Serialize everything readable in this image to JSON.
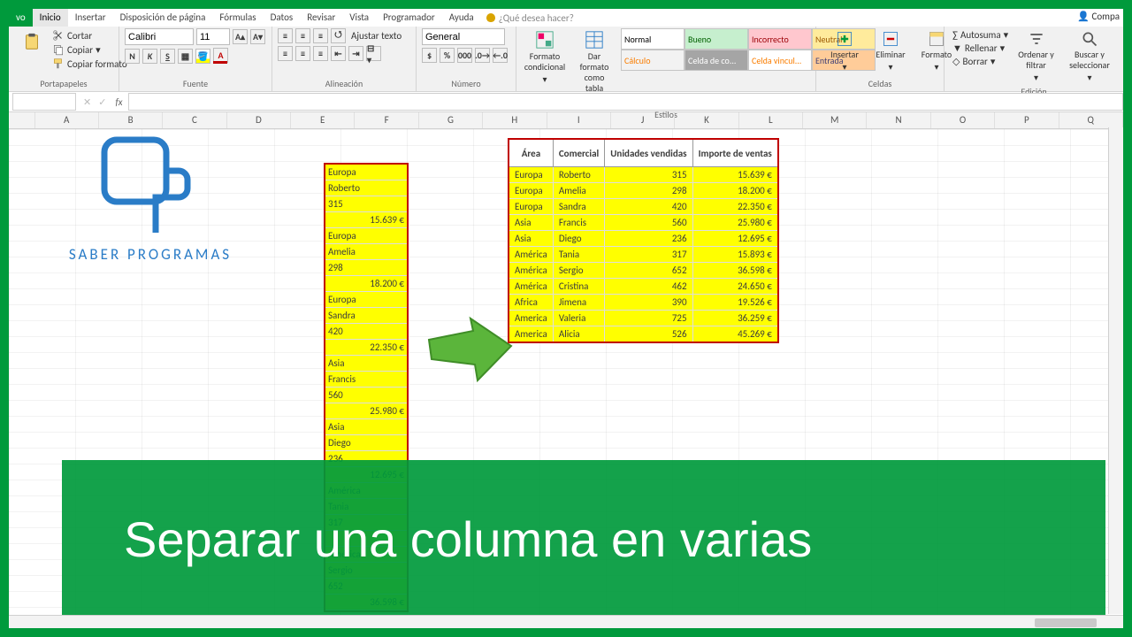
{
  "tabs": {
    "file": "vo",
    "active": "Inicio",
    "items": [
      "Insertar",
      "Disposición de página",
      "Fórmulas",
      "Datos",
      "Revisar",
      "Vista",
      "Programador",
      "Ayuda"
    ],
    "tellme": "¿Qué desea hacer?",
    "share": "Compa"
  },
  "clipboard": {
    "cut": "Cortar",
    "copy": "Copiar",
    "painter": "Copiar formato",
    "label": "Portapapeles"
  },
  "font": {
    "name": "Calibri",
    "size": "11",
    "label": "Fuente"
  },
  "alignment": {
    "wrap": "Ajustar texto",
    "label": "Alineación"
  },
  "number": {
    "format": "General",
    "label": "Número"
  },
  "styles_group": {
    "cond": "Formato condicional",
    "table": "Dar formato como tabla",
    "cells": [
      [
        "Normal",
        "#fff",
        "#000"
      ],
      [
        "Bueno",
        "#c6efce",
        "#006100"
      ],
      [
        "Incorrecto",
        "#ffc7ce",
        "#9c0006"
      ],
      [
        "Neutral",
        "#ffeb9c",
        "#9c5700"
      ],
      [
        "Cálculo",
        "#f2f2f2",
        "#fa7d00"
      ],
      [
        "Celda de co...",
        "#a5a5a5",
        "#fff"
      ],
      [
        "Celda vincul...",
        "#fff",
        "#fa7d00"
      ],
      [
        "Entrada",
        "#ffcc99",
        "#3f3f76"
      ]
    ],
    "label": "Estilos"
  },
  "cells_group": {
    "insert": "Insertar",
    "delete": "Eliminar",
    "format": "Formato",
    "label": "Celdas"
  },
  "editing": {
    "sum": "Autosuma",
    "fill": "Rellenar",
    "clear": "Borrar",
    "sort": "Ordenar y filtrar",
    "find": "Buscar y seleccionar",
    "label": "Edición"
  },
  "formula_bar": {
    "name": "",
    "fx": "fx",
    "value": ""
  },
  "columns": [
    "A",
    "B",
    "C",
    "D",
    "E",
    "F",
    "G",
    "H",
    "I",
    "J",
    "K",
    "L",
    "M",
    "N",
    "O",
    "P",
    "Q"
  ],
  "logo_text": "SABER PROGRAMAS",
  "column_list": [
    "Europa",
    "Roberto",
    "315",
    "15.639 €",
    "Europa",
    "Amelia",
    "298",
    "18.200 €",
    "Europa",
    "Sandra",
    "420",
    "22.350 €",
    "Asia",
    "Francis",
    "560",
    "25.980 €",
    "Asia",
    "Diego",
    "236",
    "12.695 €",
    "América",
    "Tania",
    "317",
    "",
    "América",
    "Sergio",
    "652",
    "36.598 €"
  ],
  "column_right_flags": [
    0,
    0,
    0,
    1,
    0,
    0,
    0,
    1,
    0,
    0,
    0,
    1,
    0,
    0,
    0,
    1,
    0,
    0,
    0,
    1,
    0,
    0,
    0,
    0,
    0,
    0,
    0,
    1
  ],
  "table": {
    "headers": [
      "Área",
      "Comercial",
      "Unidades vendidas",
      "Importe de ventas"
    ],
    "rows": [
      [
        "Europa",
        "Roberto",
        "315",
        "15.639 €"
      ],
      [
        "Europa",
        "Amelia",
        "298",
        "18.200 €"
      ],
      [
        "Europa",
        "Sandra",
        "420",
        "22.350 €"
      ],
      [
        "Asia",
        "Francis",
        "560",
        "25.980 €"
      ],
      [
        "Asia",
        "Diego",
        "236",
        "12.695 €"
      ],
      [
        "América",
        "Tania",
        "317",
        "15.893 €"
      ],
      [
        "América",
        "Sergio",
        "652",
        "36.598 €"
      ],
      [
        "América",
        "Cristina",
        "462",
        "24.650 €"
      ],
      [
        "Africa",
        "Jimena",
        "390",
        "19.526 €"
      ],
      [
        "America",
        "Valeria",
        "725",
        "36.259 €"
      ],
      [
        "America",
        "Alicia",
        "526",
        "45.269 €"
      ]
    ]
  },
  "banner": "Separar una columna en varias"
}
